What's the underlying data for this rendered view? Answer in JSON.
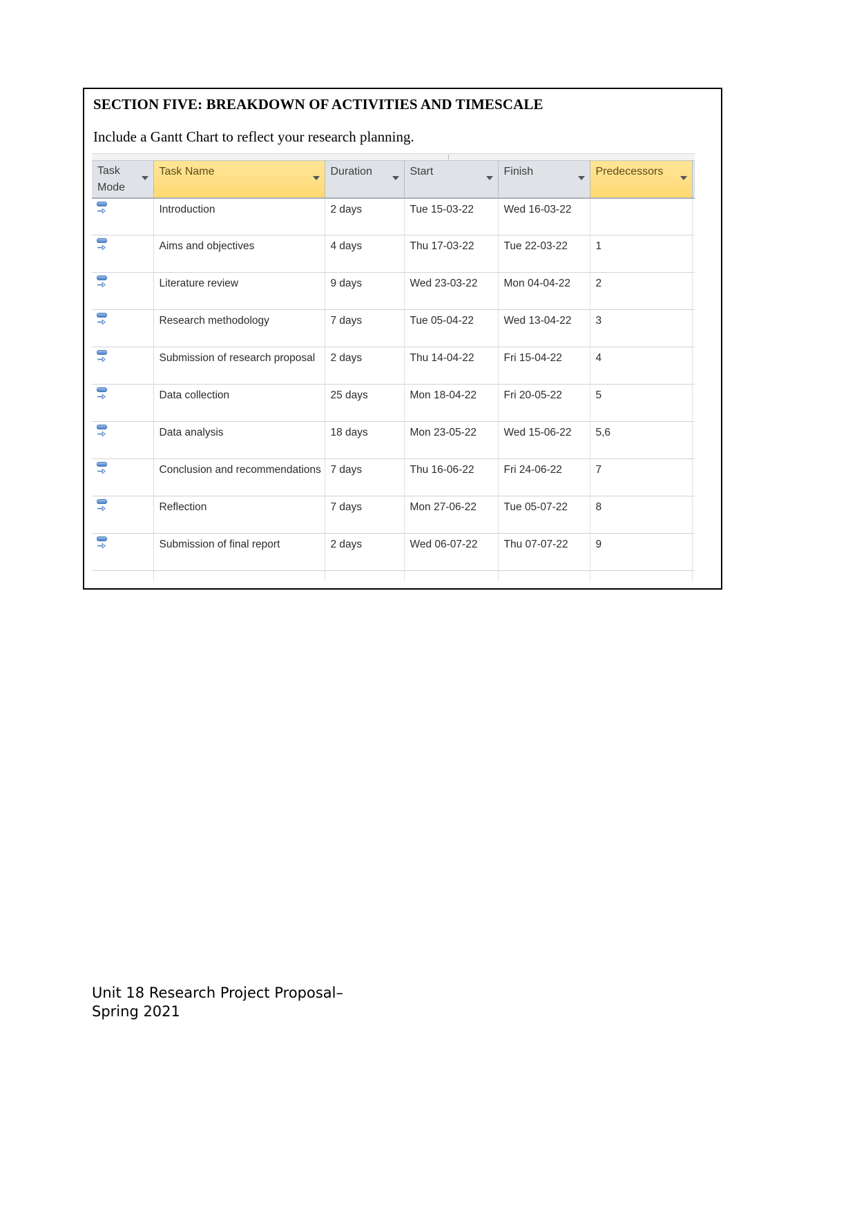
{
  "document": {
    "section_heading": "SECTION FIVE: BREAKDOWN OF ACTIVITIES AND TIMESCALE",
    "instruction": "Include a Gantt Chart to reflect your research planning."
  },
  "footer": {
    "line1": "Unit 18 Research Project Proposal–",
    "line2": "Spring 2021"
  },
  "colors": {
    "header_background": "#dfe3e8",
    "header_highlight": "#ffdf86",
    "grid_line": "#d0d3d7",
    "text": "#2b2b2b",
    "task_mode_icon": "#4d81c4"
  },
  "gantt": {
    "columns": [
      {
        "key": "task_mode",
        "label": "Task Mode",
        "label_line1": "Task",
        "label_line2": "Mode",
        "highlighted": false,
        "has_filter": true
      },
      {
        "key": "task_name",
        "label": "Task Name",
        "highlighted": true,
        "has_filter": true
      },
      {
        "key": "duration",
        "label": "Duration",
        "highlighted": false,
        "has_filter": true
      },
      {
        "key": "start",
        "label": "Start",
        "highlighted": false,
        "has_filter": true
      },
      {
        "key": "finish",
        "label": "Finish",
        "highlighted": false,
        "has_filter": true
      },
      {
        "key": "predecessors",
        "label": "Predecessors",
        "highlighted": true,
        "has_filter": true
      }
    ],
    "task_mode_icon_name": "auto-scheduled-task-icon",
    "rows": [
      {
        "id": 1,
        "task_mode": "auto-scheduled",
        "task_name": "Introduction",
        "duration": "2 days",
        "start": "Tue 15-03-22",
        "finish": "Wed 16-03-22",
        "predecessors": ""
      },
      {
        "id": 2,
        "task_mode": "auto-scheduled",
        "task_name": "Aims and objectives",
        "duration": "4 days",
        "start": "Thu 17-03-22",
        "finish": "Tue 22-03-22",
        "predecessors": "1"
      },
      {
        "id": 3,
        "task_mode": "auto-scheduled",
        "task_name": "Literature review",
        "duration": "9 days",
        "start": "Wed 23-03-22",
        "finish": "Mon 04-04-22",
        "predecessors": "2"
      },
      {
        "id": 4,
        "task_mode": "auto-scheduled",
        "task_name": "Research methodology",
        "duration": "7 days",
        "start": "Tue 05-04-22",
        "finish": "Wed 13-04-22",
        "predecessors": "3"
      },
      {
        "id": 5,
        "task_mode": "auto-scheduled",
        "task_name": "Submission of research proposal",
        "duration": "2 days",
        "start": "Thu 14-04-22",
        "finish": "Fri 15-04-22",
        "predecessors": "4"
      },
      {
        "id": 6,
        "task_mode": "auto-scheduled",
        "task_name": "Data collection",
        "duration": "25 days",
        "start": "Mon 18-04-22",
        "finish": "Fri 20-05-22",
        "predecessors": "5"
      },
      {
        "id": 7,
        "task_mode": "auto-scheduled",
        "task_name": "Data analysis",
        "duration": "18 days",
        "start": "Mon 23-05-22",
        "finish": "Wed 15-06-22",
        "predecessors": "5,6"
      },
      {
        "id": 8,
        "task_mode": "auto-scheduled",
        "task_name": "Conclusion and recommendations",
        "duration": "7 days",
        "start": "Thu 16-06-22",
        "finish": "Fri 24-06-22",
        "predecessors": "7"
      },
      {
        "id": 9,
        "task_mode": "auto-scheduled",
        "task_name": "Reflection",
        "duration": "7 days",
        "start": "Mon 27-06-22",
        "finish": "Tue 05-07-22",
        "predecessors": "8"
      },
      {
        "id": 10,
        "task_mode": "auto-scheduled",
        "task_name": "Submission of final report",
        "duration": "2 days",
        "start": "Wed 06-07-22",
        "finish": "Thu 07-07-22",
        "predecessors": "9"
      }
    ]
  },
  "chart_data": {
    "type": "table",
    "title": "Research project Gantt chart task schedule",
    "columns": [
      "Task Mode",
      "Task Name",
      "Duration",
      "Start",
      "Finish",
      "Predecessors"
    ],
    "rows": [
      [
        "auto-scheduled",
        "Introduction",
        "2 days",
        "Tue 15-03-22",
        "Wed 16-03-22",
        ""
      ],
      [
        "auto-scheduled",
        "Aims and objectives",
        "4 days",
        "Thu 17-03-22",
        "Tue 22-03-22",
        "1"
      ],
      [
        "auto-scheduled",
        "Literature review",
        "9 days",
        "Wed 23-03-22",
        "Mon 04-04-22",
        "2"
      ],
      [
        "auto-scheduled",
        "Research methodology",
        "7 days",
        "Tue 05-04-22",
        "Wed 13-04-22",
        "3"
      ],
      [
        "auto-scheduled",
        "Submission of research proposal",
        "2 days",
        "Thu 14-04-22",
        "Fri 15-04-22",
        "4"
      ],
      [
        "auto-scheduled",
        "Data collection",
        "25 days",
        "Mon 18-04-22",
        "Fri 20-05-22",
        "5"
      ],
      [
        "auto-scheduled",
        "Data analysis",
        "18 days",
        "Mon 23-05-22",
        "Wed 15-06-22",
        "5,6"
      ],
      [
        "auto-scheduled",
        "Conclusion and recommendations",
        "7 days",
        "Thu 16-06-22",
        "Fri 24-06-22",
        "7"
      ],
      [
        "auto-scheduled",
        "Reflection",
        "7 days",
        "Mon 27-06-22",
        "Tue 05-07-22",
        "8"
      ],
      [
        "auto-scheduled",
        "Submission of final report",
        "2 days",
        "Wed 06-07-22",
        "Thu 07-07-22",
        "9"
      ]
    ]
  }
}
